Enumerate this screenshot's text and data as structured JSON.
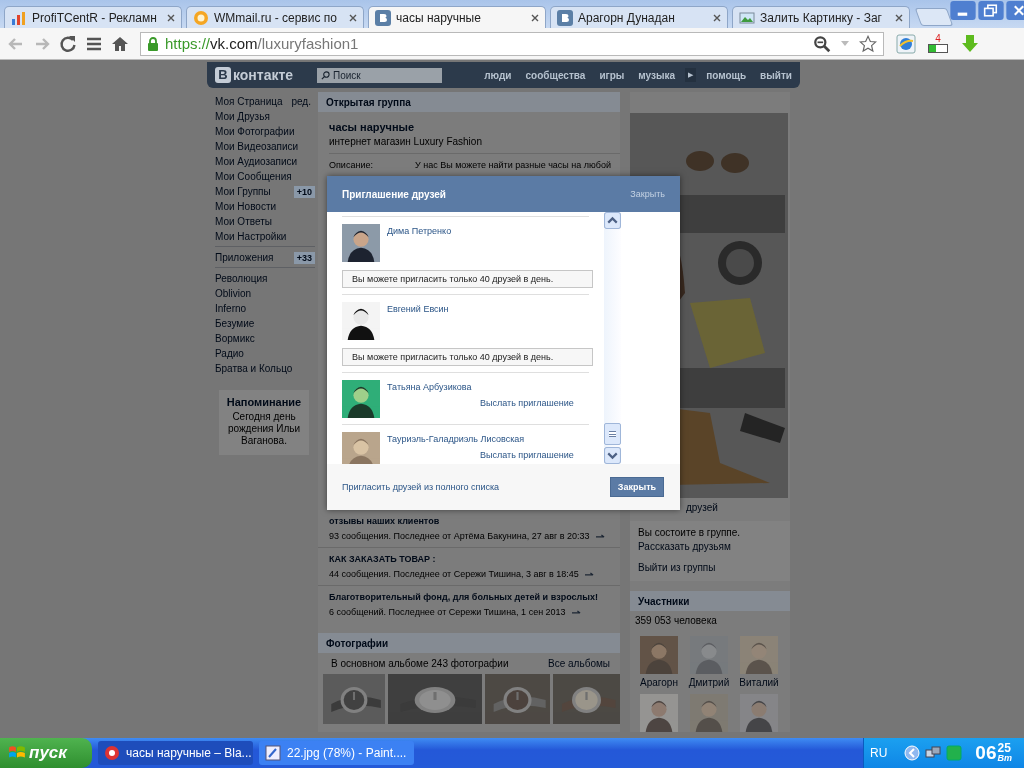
{
  "browser": {
    "tabs": [
      {
        "title": "ProfiTCentR - Рекламн",
        "selected": false
      },
      {
        "title": "WMmail.ru - сервис по",
        "selected": false
      },
      {
        "title": "часы наручные",
        "selected": true
      },
      {
        "title": "Арагорн Дунадан",
        "selected": false
      },
      {
        "title": "Залить Картинку - Заг",
        "selected": false
      }
    ],
    "address": {
      "scheme": "https://",
      "host": "vk.com",
      "path": "/luxuryfashion1"
    },
    "extension_badge": "4"
  },
  "vk": {
    "logo": {
      "mark": "В",
      "text": "контакте"
    },
    "search": {
      "placeholder": "Поиск"
    },
    "nav": [
      {
        "kind": "link",
        "label": "люди"
      },
      {
        "kind": "link",
        "label": "сообщества"
      },
      {
        "kind": "link",
        "label": "игры"
      },
      {
        "kind": "link",
        "label": "музыка"
      },
      {
        "kind": "arrow",
        "label": "▶"
      },
      {
        "kind": "link",
        "label": "помощь"
      },
      {
        "kind": "link",
        "label": "выйти"
      }
    ],
    "sidebar": {
      "sections": [
        [
          {
            "label": "Моя Страница",
            "extra": "ред."
          },
          {
            "label": "Мои Друзья"
          },
          {
            "label": "Мои Фотографии"
          },
          {
            "label": "Мои Видеозаписи"
          },
          {
            "label": "Мои Аудиозаписи"
          },
          {
            "label": "Мои Сообщения"
          },
          {
            "label": "Мои Группы",
            "badge": "+10"
          },
          {
            "label": "Мои Новости"
          },
          {
            "label": "Мои Ответы"
          },
          {
            "label": "Мои Настройки"
          }
        ],
        [
          {
            "label": "Приложения",
            "badge": "+33"
          }
        ],
        [
          {
            "label": "Революция"
          },
          {
            "label": "Oblivion"
          },
          {
            "label": "Inferno"
          },
          {
            "label": "Безумие"
          },
          {
            "label": "Вормикс"
          },
          {
            "label": "Радио"
          },
          {
            "label": "Братва и Кольцо"
          }
        ]
      ],
      "reminder": {
        "title": "Напоминание",
        "text": "Сегодня день рождения Ильи Ваганова."
      }
    },
    "group": {
      "type": "Открытая группа",
      "name": "часы наручные",
      "subtitle": "интернет магазин Luxury Fashion",
      "description_label": "Описание:",
      "description": "У нас Вы можете найти разные часы на любой"
    },
    "topics": [
      {
        "title": "отзывы наших клиентов",
        "meta": "93 сообщения. Последнее от Артёма Бакунина, 27 авг в 20:33"
      },
      {
        "title": "КАК ЗАКАЗАТЬ ТОВАР :",
        "meta": "44 сообщения. Последнее от Сережи Тишина, 3 авг в 18:45"
      },
      {
        "title": "Благотворительный фонд, для больных детей и взрослых!",
        "meta": "6 сообщений. Последнее от Сережи Тишина, 1 сен 2013"
      }
    ],
    "photos": {
      "title": "Фотографии",
      "count": "В основном альбоме 243 фотографии",
      "all": "Все альбомы",
      "items": [
        {
          "kind": "picture"
        },
        {
          "kind": "picture"
        },
        {
          "kind": "picture"
        },
        {
          "kind": "picture"
        }
      ]
    },
    "right": {
      "banner": {
        "kind": "picture"
      },
      "invite_tail": "друзей",
      "membership": {
        "status": "Вы состоите в группе.",
        "tell": "Рассказать друзьям",
        "leave": "Выйти из группы"
      },
      "members": {
        "title": "Участники",
        "count": "359 053 человека",
        "people": [
          {
            "kind": "picture",
            "name": "Арагорн"
          },
          {
            "kind": "picture",
            "name": "Дмитрий"
          },
          {
            "kind": "picture",
            "name": "Виталий"
          },
          {
            "kind": "picture"
          },
          {
            "kind": "picture"
          },
          {
            "kind": "picture"
          }
        ]
      }
    }
  },
  "modal": {
    "title": "Приглашение друзей",
    "close_link": "Закрыть",
    "friends": [
      {
        "name": "Дима Петренко",
        "kind": "notice",
        "text": "Вы можете пригласить только 40 друзей в день."
      },
      {
        "name": "Евгений Евсин",
        "kind": "notice",
        "text": "Вы можете пригласить только 40 друзей в день."
      },
      {
        "name": "Татьяна Арбузикова",
        "kind": "invite",
        "text": "Выслать приглашение"
      },
      {
        "name": "Тауриэль-Галадриэль Лисовская",
        "kind": "invite",
        "text": "Выслать приглашение"
      }
    ],
    "footer_link": "Пригласить друзей из полного списка",
    "close_button": "Закрыть"
  },
  "taskbar": {
    "start": "пуск",
    "tasks": [
      {
        "title": "часы наручные – Bla...",
        "selected": true
      },
      {
        "title": "22.jpg (78%) - Paint....",
        "selected": false
      }
    ],
    "lang": "RU",
    "clock": {
      "hours": "06",
      "minutes": "25",
      "day": "Вт"
    }
  }
}
